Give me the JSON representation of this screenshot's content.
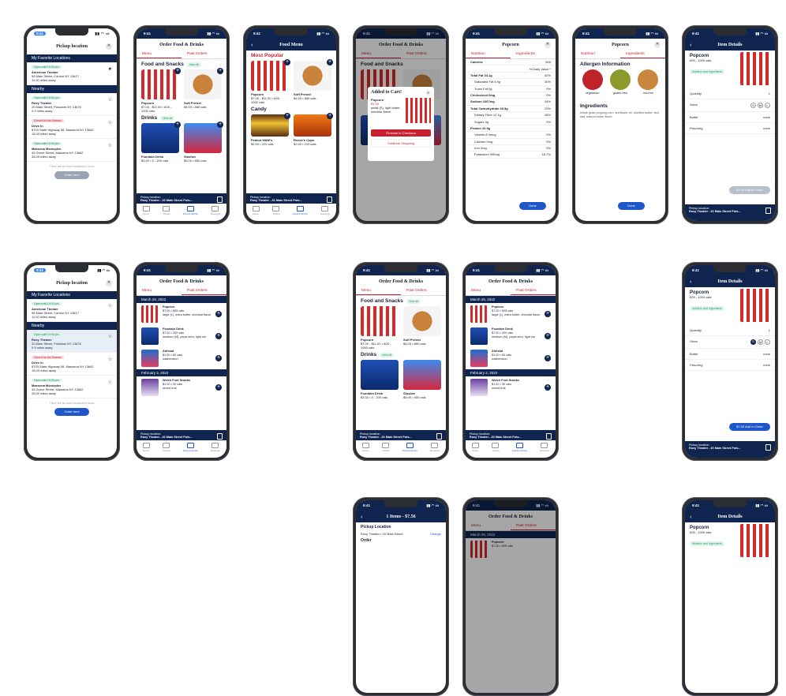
{
  "status": {
    "time": "9:41"
  },
  "pickup": {
    "title": "Pickup location",
    "favorites_header": "My Favorite Locations",
    "nearby_header": "Nearby",
    "locations": [
      {
        "tag": "Open until 10:00 pm",
        "name": "American Theater",
        "addr": "98 Main Street, Canton NY 13617",
        "dist": "11.00 miles away"
      },
      {
        "tag": "Open until 10:00 pm",
        "name": "Roxy Theater",
        "addr": "20 Main Street, Potsdam NY 13676",
        "dist": "0.9 miles away"
      },
      {
        "tag": "Closed for the Season",
        "name": "Drive In",
        "addr": "8703 State Highway 56, Massena NY 13662",
        "dist": "18.00 miles away"
      },
      {
        "tag": "Open until 10:00 pm",
        "name": "Massena Movieplex",
        "addr": "49 Grove Street, Massena NY 13662",
        "dist": "28.00 miles away"
      }
    ],
    "more_text": "There are no more locations to show",
    "order_btn": "Order here"
  },
  "order": {
    "title": "Order Food & Drinks",
    "tab_menu": "Menu",
    "tab_past": "Past Orders",
    "sec_food": "Food and Snacks",
    "view_all": "View all",
    "sec_drinks": "Drinks",
    "items": [
      {
        "name": "Popcorn",
        "price": "$7.00 - $11.00 • 605 - 1000 cals"
      },
      {
        "name": "Soft Pretzel",
        "price": "$4.00 • 880 cals"
      },
      {
        "name": "Fountain Drink",
        "price": "$3.00 • 0 - 200 cals"
      },
      {
        "name": "Slushee",
        "price": "$5.00 • 650 cals"
      }
    ],
    "pickup_label": "Pickup location",
    "pickup_value": "Roxy Theater - 20 Main Street Pots...",
    "nav": [
      "Home",
      "Tickets",
      "Food & Drinks",
      "Rewards"
    ]
  },
  "menu": {
    "title": "Food Menu",
    "sec_popular": "Most Popular",
    "sec_candy": "Candy",
    "candy": [
      {
        "name": "Peanut M&M's",
        "price": "$2.00 • 220 cals"
      },
      {
        "name": "Reese's Cups",
        "price": "$2.00 • 210 cals"
      }
    ]
  },
  "cart": {
    "title": "Added to Cart!",
    "item": "Popcorn",
    "price": "$7.00",
    "desc": "small (S), light butter, cheddar flavor",
    "checkout": "Proceed to Checkout",
    "continue": "Continue Shopping"
  },
  "nutrition": {
    "title": "Popcorn",
    "tab_nutrition": "Nutrition",
    "tab_ingredients": "Ingredients",
    "rows": [
      [
        "Calories",
        "605"
      ],
      [
        "",
        "% Daily Value *"
      ],
      [
        "Total Fat 34.1g",
        "52%"
      ],
      [
        "Saturated Fat 5.9g",
        "30%"
      ],
      [
        "Trans Fat 0g",
        "0%"
      ],
      [
        "Cholesterol 0mg",
        "0%"
      ],
      [
        "Sodium 1067mg",
        "44%"
      ],
      [
        "Total Carbohydrate 69.3g",
        "23%"
      ],
      [
        "Dietary Fiber 12.1g",
        "48%"
      ],
      [
        "Sugars 0g",
        "0%"
      ],
      [
        "Protein 10.9g",
        ""
      ],
      [
        "Vitamin A 0mcg",
        "0%"
      ],
      [
        "Calcium 0mg",
        "0%"
      ],
      [
        "Iron 0mg",
        "0%"
      ],
      [
        "Potassium 990mg",
        "18.7%"
      ]
    ],
    "done": "Done"
  },
  "ingredients": {
    "allergen_header": "Allergen Information",
    "allergens": [
      "vegetarian",
      "gluten-free",
      "nut-free"
    ],
    "ing_header": "Ingredients",
    "ing_text": "whole grain popping corn, sunflower oil, clarified butter, sea salt, natural butter flavor"
  },
  "details": {
    "title": "Item Details",
    "name": "Popcorn",
    "cals": "605 - 1000 cals",
    "link": "Nutrition and Ingredients",
    "quantity": "Quantity",
    "qty": "1",
    "sizes": "Sizes",
    "size_opts": [
      "S",
      "M",
      "L"
    ],
    "butter": "Butter",
    "flavoring": "Flavoring",
    "none": "none",
    "add_btn": "$7.00 Add to Order"
  },
  "past": {
    "date1": "March 29, 2022",
    "date2": "February 2, 2022",
    "items": [
      {
        "name": "Popcorn",
        "l1": "$7.00 • 605 cals",
        "l2": "large (L), extra butter, cheddar flavor"
      },
      {
        "name": "Fountain Drink",
        "l1": "$7.00 • 200 cals",
        "l2": "medium (M), pepsi zero, light ice"
      },
      {
        "name": "Airhead",
        "l1": "$1.00 • 60 cals",
        "l2": "watermelon"
      },
      {
        "name": "Welch Fruit Snacks",
        "l1": "$1.00 • 90 cals",
        "l2": "mixed fruit"
      }
    ]
  },
  "checkout": {
    "title": "1 Items - $7.56",
    "pickup_header": "Pickup Location",
    "pickup_value": "Roxy Theater • 20 Main Street",
    "change": "Change",
    "order_header": "Order"
  }
}
